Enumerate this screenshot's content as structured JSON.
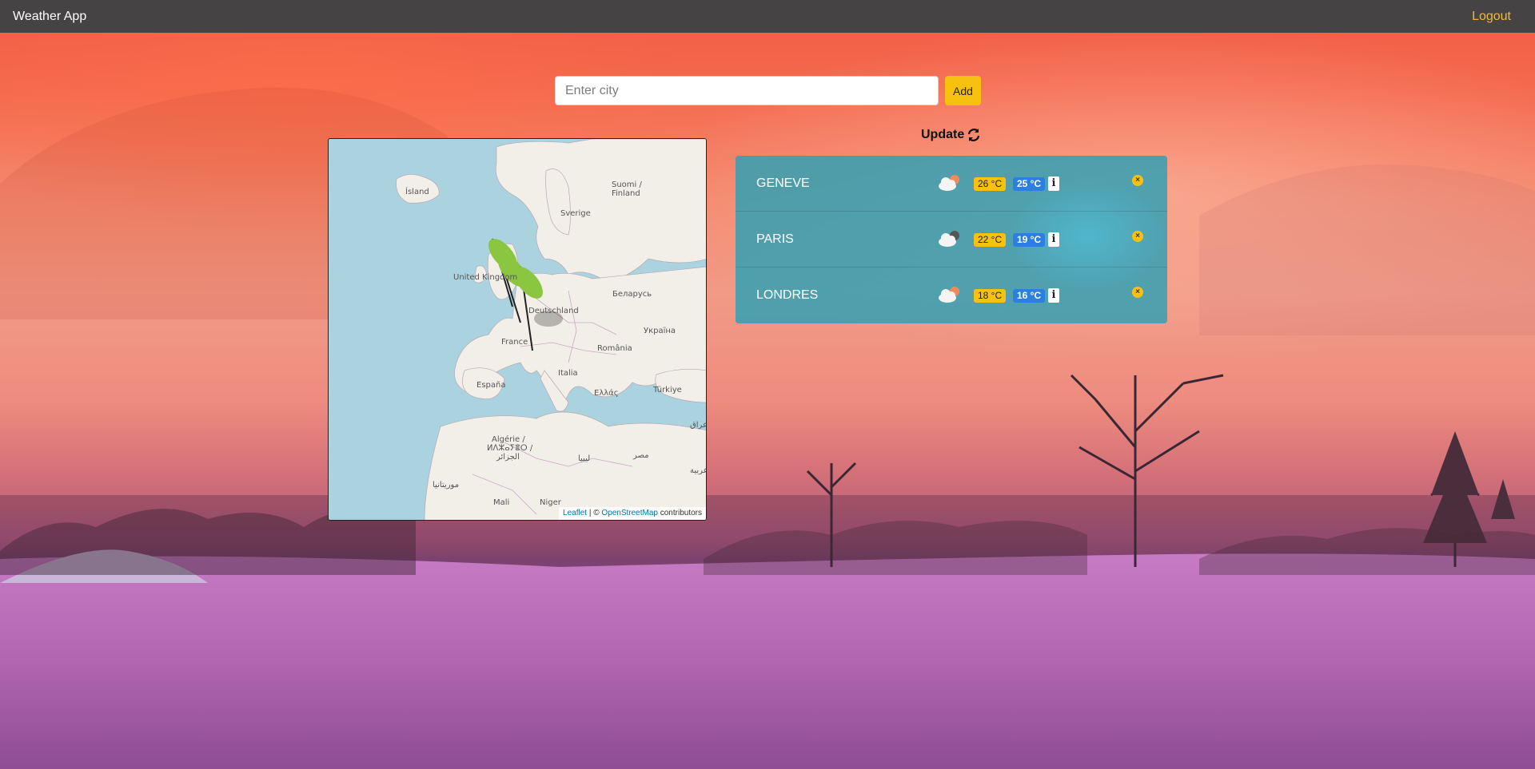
{
  "navbar": {
    "brand": "Weather App",
    "logout": "Logout"
  },
  "search": {
    "placeholder": "Enter city",
    "value": "",
    "add_label": "Add"
  },
  "update": {
    "label": "Update",
    "icon": "refresh-icon"
  },
  "map": {
    "labels": {
      "island": "Ísland",
      "suomi": "Suomi /",
      "finland": "Finland",
      "sverige": "Sverige",
      "uk": "United Kingdom",
      "belarus": "Беларусь",
      "deutschland": "Deutschland",
      "ukraina": "Україна",
      "france": "France",
      "romania": "România",
      "italia": "Italia",
      "espana": "España",
      "ellas": "Ελλάς",
      "turkiye": "Türkiye",
      "algerie": "Algérie /",
      "algerie_tif": "ⵍⴷⵣⴰⵢⴻⵔ /",
      "algerie_ar": "الجزائر",
      "libya": "ليبيا",
      "misr": "مصر",
      "iraq": "عراق",
      "saudi": "عربية",
      "mauritanie": "موريتانيا",
      "mali": "Mali",
      "niger": "Niger"
    },
    "attribution": {
      "leaflet": "Leaflet",
      "separator": "| ©",
      "osm": "OpenStreetMap",
      "contributors": "contributors"
    },
    "marker_icon": "leaf-marker-icon"
  },
  "cities": [
    {
      "name": "GENEVE",
      "icon": "cloud-sun-icon",
      "max": "26 °C",
      "min": "25 °C",
      "info": "i",
      "close": "×"
    },
    {
      "name": "PARIS",
      "icon": "cloud-moon-icon",
      "max": "22 °C",
      "min": "19 °C",
      "info": "i",
      "close": "×"
    },
    {
      "name": "LONDRES",
      "icon": "cloud-sun-icon",
      "max": "18 °C",
      "min": "16 °C",
      "info": "i",
      "close": "×"
    }
  ],
  "colors": {
    "navbar": "#464345",
    "accent_yellow": "#f7c10f",
    "logout": "#f6b732",
    "min_badge": "#2b7fe0",
    "cities_panel": "#32a0b4"
  }
}
